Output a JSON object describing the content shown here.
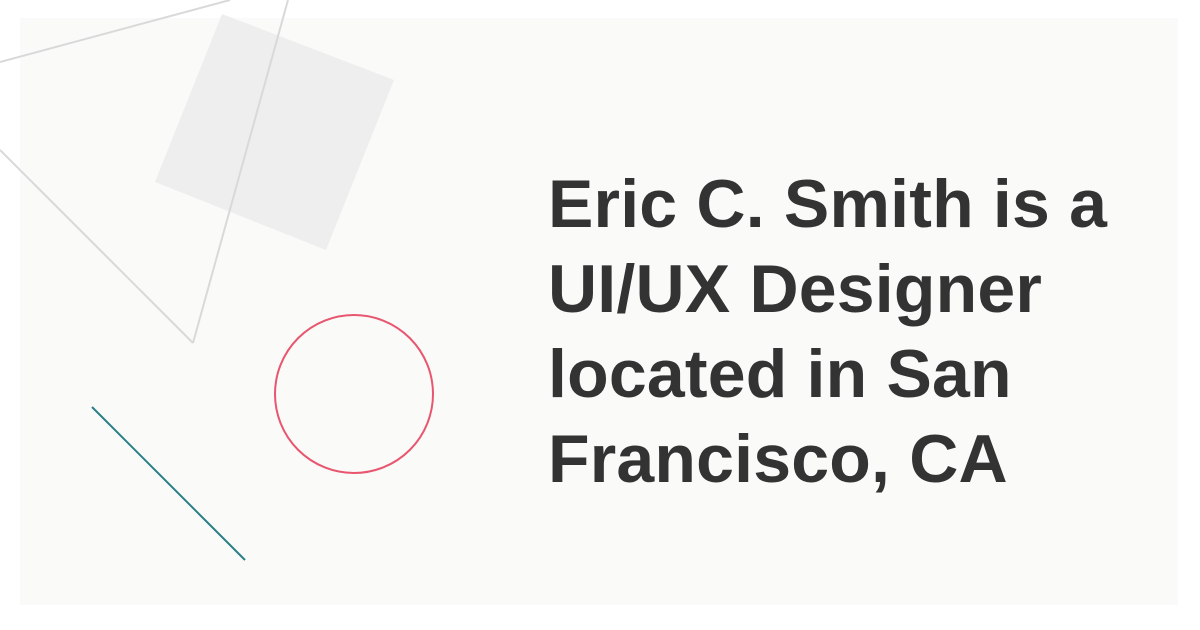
{
  "headline": {
    "lines": [
      "Eric C. Smith is a",
      "UI/UX Designer",
      "located in San",
      "Francisco, CA"
    ]
  },
  "colors": {
    "background": "#ffffff",
    "card": "#fafaf9",
    "text": "#333333",
    "shape_fill": "#eeeeee",
    "line_gray": "#d9d9d9",
    "circle_red": "#e8566f",
    "line_teal": "#2a7f87"
  },
  "decor": {
    "shapes": [
      "gray-square",
      "gray-triangle-outline",
      "red-circle-outline",
      "teal-line"
    ]
  }
}
